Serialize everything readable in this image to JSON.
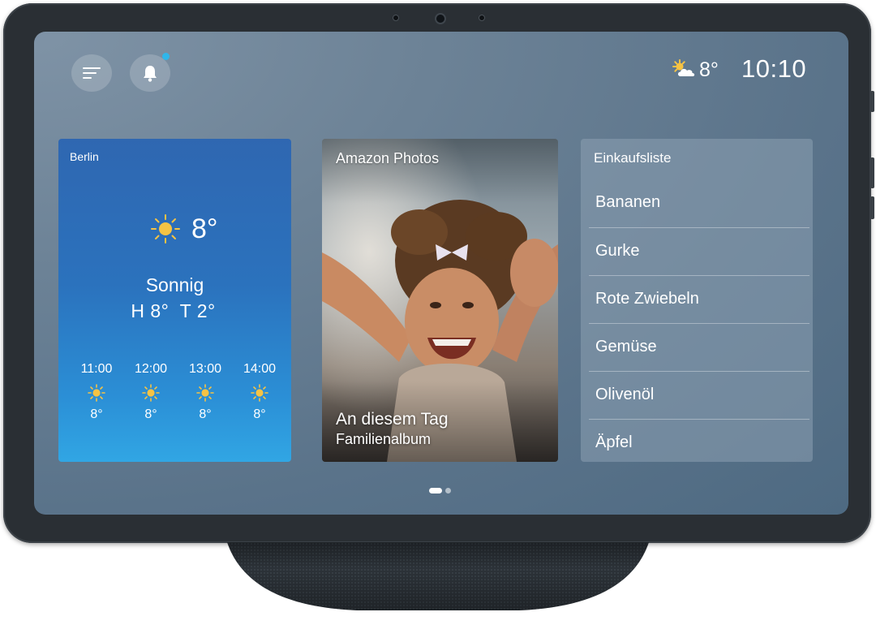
{
  "status_bar": {
    "menu_icon": "menu-icon",
    "notification_icon": "bell-icon",
    "notification_indicator_color": "#2fb6ea",
    "weather_icon": "partly-cloudy-icon",
    "temperature": "8°",
    "time": "10:10"
  },
  "weather_card": {
    "city": "Berlin",
    "icon": "sun-icon",
    "temperature": "8°",
    "condition": "Sonnig",
    "high_low": "H 8°  T 2°",
    "hourly": [
      {
        "time": "11:00",
        "icon": "sun-icon",
        "temp": "8°"
      },
      {
        "time": "12:00",
        "icon": "sun-icon",
        "temp": "8°"
      },
      {
        "time": "13:00",
        "icon": "sun-icon",
        "temp": "8°"
      },
      {
        "time": "14:00",
        "icon": "sun-icon",
        "temp": "8°"
      }
    ],
    "colors": {
      "top": "#2f67b1",
      "bottom": "#31a6e4"
    }
  },
  "photo_card": {
    "title": "Amazon Photos",
    "caption": "An diesem Tag",
    "album": "Familienalbum"
  },
  "shopping_list": {
    "title": "Einkaufsliste",
    "items": [
      "Bananen",
      "Gurke",
      "Rote Zwiebeln",
      "Gemüse",
      "Olivenöl",
      "Äpfel"
    ]
  },
  "pager": {
    "pages": 2,
    "active_page": 1
  },
  "colors": {
    "device_frame": "#2a2f34",
    "screen_background": "#5a738a",
    "sun": "#f6c344"
  }
}
